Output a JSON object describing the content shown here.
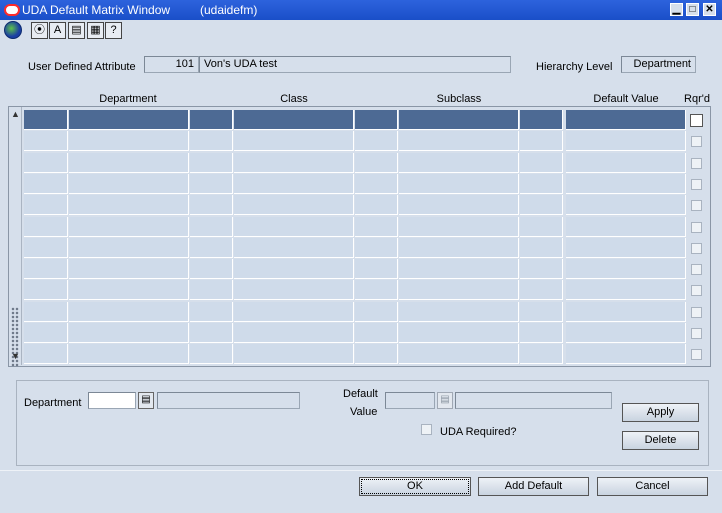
{
  "window": {
    "title": "UDA Default Matrix Window",
    "id": "(udaidefm)",
    "minimize": "▁",
    "maximize": "□",
    "close": "✕"
  },
  "toolbar": {
    "buttons": [
      "globe-icon",
      "save-icon",
      "spellcheck-icon",
      "notes-icon",
      "print-icon",
      "help-icon"
    ],
    "glyphs": [
      "",
      "⦿",
      "A",
      "▤",
      "▦",
      "?"
    ]
  },
  "header": {
    "uda_label": "User Defined Attribute",
    "uda_id": "101",
    "uda_desc": "Von's UDA test",
    "hierarchy_label": "Hierarchy Level",
    "hierarchy_value": "Department"
  },
  "grid": {
    "columns": [
      "Department",
      "Class",
      "Subclass",
      "Default Value",
      "Rqr'd"
    ],
    "row_count": 12
  },
  "detail": {
    "department_label": "Department",
    "department_value": "",
    "department_desc": "",
    "default_value_label_1": "Default",
    "default_value_label_2": "Value",
    "default_value": "",
    "default_value_desc": "",
    "uda_required_label": "UDA Required?",
    "apply_label": "Apply",
    "delete_label": "Delete"
  },
  "footer": {
    "ok_label": "OK",
    "add_default_label": "Add Default",
    "cancel_label": "Cancel"
  },
  "colors": {
    "titlebar": "#1a4fc8",
    "window_bg": "#d6dfeb",
    "selected_row": "#4d6a94",
    "grid_row": "#cfdbea"
  }
}
